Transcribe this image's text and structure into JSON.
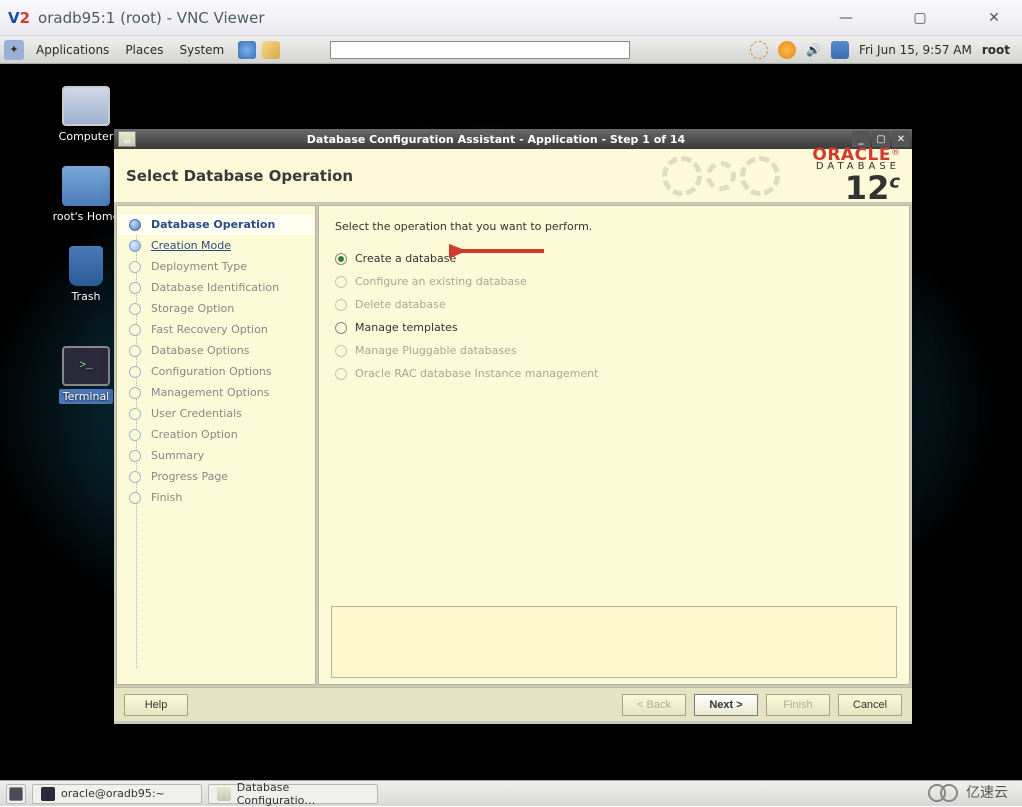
{
  "vnc": {
    "title": "oradb95:1 (root) - VNC Viewer",
    "controls": {
      "min": "—",
      "max": "▢",
      "close": "✕"
    }
  },
  "gnome": {
    "apps": "Applications",
    "places": "Places",
    "system": "System",
    "clock": "Fri Jun 15,  9:57 AM",
    "user": "root"
  },
  "desktop": {
    "computer": "Computer",
    "home": "root's Home",
    "trash": "Trash",
    "terminal": "Terminal"
  },
  "dbca": {
    "win_title": "Database Configuration Assistant - Application - Step 1 of 14",
    "header": "Select Database Operation",
    "brand": {
      "name": "ORACLE",
      "sub": "DATABASE",
      "ver": "12",
      "sup": "c"
    },
    "steps": [
      "Database Operation",
      "Creation Mode",
      "Deployment Type",
      "Database Identification",
      "Storage Option",
      "Fast Recovery Option",
      "Database Options",
      "Configuration Options",
      "Management Options",
      "User Credentials",
      "Creation Option",
      "Summary",
      "Progress Page",
      "Finish"
    ],
    "prompt": "Select the operation that you want to perform.",
    "options": [
      {
        "label": "Create a database",
        "state": "selected"
      },
      {
        "label": "Configure an existing database",
        "state": "disabled"
      },
      {
        "label": "Delete database",
        "state": "disabled"
      },
      {
        "label": "Manage templates",
        "state": "enabled"
      },
      {
        "label": "Manage Pluggable databases",
        "state": "disabled"
      },
      {
        "label": "Oracle RAC database Instance management",
        "state": "disabled"
      }
    ],
    "buttons": {
      "help": "Help",
      "back": "< Back",
      "next": "Next >",
      "finish": "Finish",
      "cancel": "Cancel"
    }
  },
  "taskbar": {
    "t1": "oracle@oradb95:~",
    "t2": "Database Configuratio…"
  },
  "watermark": "亿速云"
}
